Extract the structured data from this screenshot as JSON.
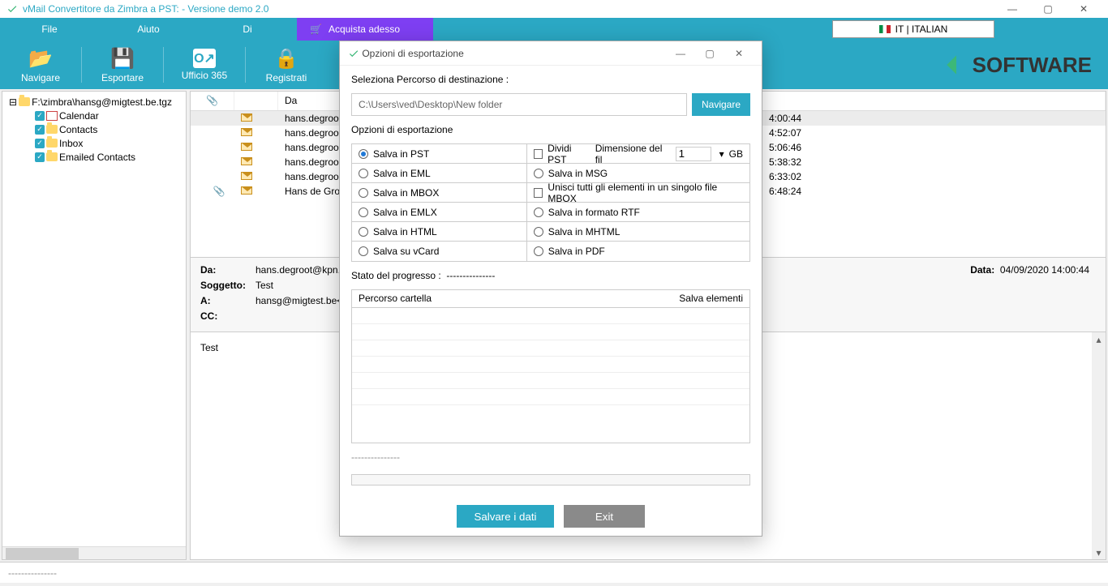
{
  "title": "vMail Convertitore da Zimbra a PST: - Versione demo 2.0",
  "menu": {
    "file": "File",
    "help": "Aiuto",
    "about": "Di",
    "buy": "Acquista adesso",
    "lang": "IT | ITALIAN"
  },
  "toolbar": {
    "nav": "Navigare",
    "export": "Esportare",
    "office": "Ufficio 365",
    "register": "Registrati"
  },
  "brand": "SOFTWARE",
  "tree": {
    "root": "F:\\zimbra\\hansg@migtest.be.tgz",
    "items": [
      {
        "label": "Calendar"
      },
      {
        "label": "Contacts"
      },
      {
        "label": "Inbox"
      },
      {
        "label": "Emailed Contacts"
      }
    ]
  },
  "list": {
    "headers": {
      "att": "📎",
      "icon": "",
      "from": "Da"
    },
    "rows": [
      {
        "from": "hans.degroo",
        "time": "4:00:44"
      },
      {
        "from": "hans.degroo",
        "time": "4:52:07"
      },
      {
        "from": "hans.degroo",
        "time": "5:06:46"
      },
      {
        "from": "hans.degroo",
        "time": "5:38:32"
      },
      {
        "from": "hans.degroo",
        "time": "6:33:02"
      },
      {
        "from": "Hans de Gro",
        "time": "6:48:24"
      }
    ]
  },
  "meta": {
    "from_lbl": "Da:",
    "from_val": "hans.degroot@kpn.com<",
    "subj_lbl": "Soggetto:",
    "subj_val": "Test",
    "to_lbl": "A:",
    "to_val": "hansg@migtest.be<hansg",
    "cc_lbl": "CC:",
    "date_lbl": "Data:",
    "date_val": "04/09/2020 14:00:44"
  },
  "body": "Test",
  "status": "---------------",
  "dialog": {
    "title": "Opzioni di esportazione",
    "dest_lbl": "Seleziona Percorso di destinazione :",
    "dest_val": "C:\\Users\\ved\\Desktop\\New folder",
    "dest_btn": "Navigare",
    "opts_lbl": "Opzioni di esportazione",
    "options": {
      "pst": "Salva in PST",
      "split": "Dividi PST",
      "dim_lbl": "Dimensione del fil",
      "dim_val": "1",
      "gb": "GB",
      "eml": "Salva in EML",
      "msg": "Salva in MSG",
      "mbox": "Salva in MBOX",
      "merge": "Unisci tutti gli elementi in un singolo file MBOX",
      "emlx": "Salva in EMLX",
      "rtf": "Salva in formato RTF",
      "html": "Salva in HTML",
      "mhtml": "Salva in MHTML",
      "vcard": "Salva su vCard",
      "pdf": "Salva in PDF"
    },
    "progress_lbl": "Stato del progresso :",
    "progress_val": "---------------",
    "progress_cols": {
      "path": "Percorso cartella",
      "items": "Salva elementi"
    },
    "dashes": "---------------",
    "save": "Salvare i dati",
    "exit": "Exit"
  }
}
